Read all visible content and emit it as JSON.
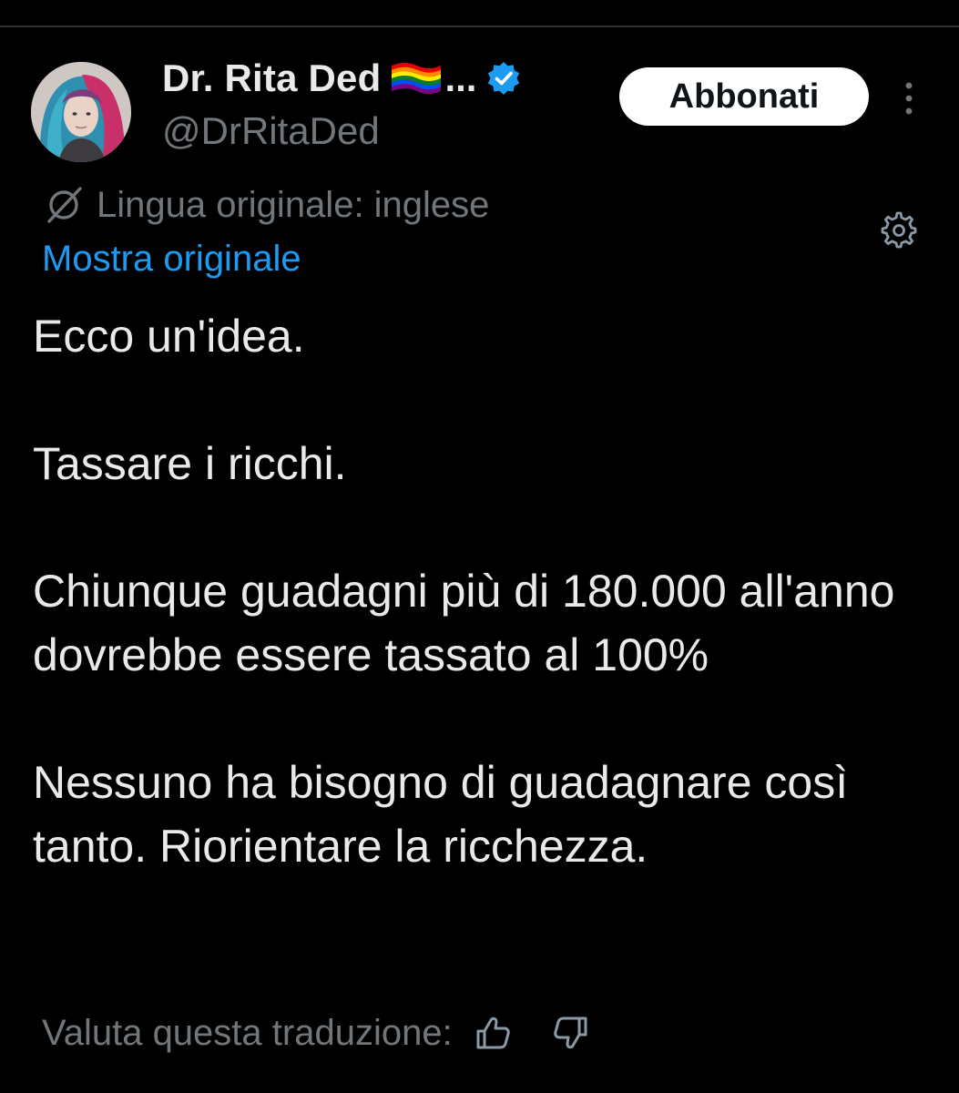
{
  "author": {
    "display_name": "Dr. Rita Ded",
    "name_truncation": "...",
    "handle": "@DrRitaDed",
    "verified": true,
    "verified_color": "#1d9bf0",
    "flag_icon": "rainbow-flag-icon"
  },
  "header": {
    "subscribe_label": "Abbonati",
    "more_icon": "more-vertical-icon"
  },
  "translation": {
    "icon": "translate-icon",
    "original_language": "Lingua originale: inglese",
    "show_original_label": "Mostra originale",
    "settings_icon": "gear-icon",
    "rate_label": "Valuta questa traduzione:",
    "thumb_up_icon": "thumb-up-icon",
    "thumb_down_icon": "thumb-down-icon"
  },
  "tweet": {
    "paragraphs": [
      "Ecco un'idea.",
      "Tassare i ricchi.",
      "Chiunque guadagni più di 180.000 all'anno dovrebbe essere tassato al 100%",
      "Nessuno ha bisogno di guadagnare così tanto. Riorientare la ricchezza."
    ]
  },
  "colors": {
    "background": "#000000",
    "text_primary": "#e7e9ea",
    "text_secondary": "#71767b",
    "link": "#1d9bf0",
    "button_bg": "#ffffff",
    "button_text": "#0f1419"
  }
}
